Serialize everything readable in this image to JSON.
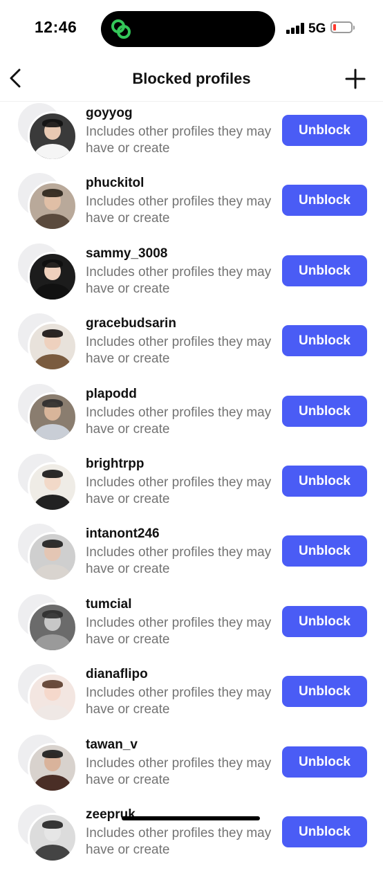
{
  "status_bar": {
    "time": "12:46",
    "network": "5G",
    "battery_color": "#ff3b30"
  },
  "header": {
    "title": "Blocked profiles",
    "back_icon": "chevron-left-icon",
    "add_icon": "plus-icon"
  },
  "colors": {
    "accent": "#4a5cf5",
    "secondary_text": "#737373"
  },
  "blocked_profiles": [
    {
      "username": "goyyog",
      "description": "Includes other profiles they may have or create",
      "button": "Unblock"
    },
    {
      "username": "phuckitol",
      "description": "Includes other profiles they may have or create",
      "button": "Unblock"
    },
    {
      "username": "sammy_3008",
      "description": "Includes other profiles they may have or create",
      "button": "Unblock"
    },
    {
      "username": "gracebudsarin",
      "description": "Includes other profiles they may have or create",
      "button": "Unblock"
    },
    {
      "username": "plapodd",
      "description": "Includes other profiles they may have or create",
      "button": "Unblock"
    },
    {
      "username": "brightrpp",
      "description": "Includes other profiles they may have or create",
      "button": "Unblock"
    },
    {
      "username": "intanont246",
      "description": "Includes other profiles they may have or create",
      "button": "Unblock"
    },
    {
      "username": "tumcial",
      "description": "Includes other profiles they may have or create",
      "button": "Unblock"
    },
    {
      "username": "dianaflipo",
      "description": "Includes other profiles they may have or create",
      "button": "Unblock"
    },
    {
      "username": "tawan_v",
      "description": "Includes other profiles they may have or create",
      "button": "Unblock"
    },
    {
      "username": "zeepruk",
      "description": "Includes other profiles they may have or create",
      "button": "Unblock"
    }
  ]
}
